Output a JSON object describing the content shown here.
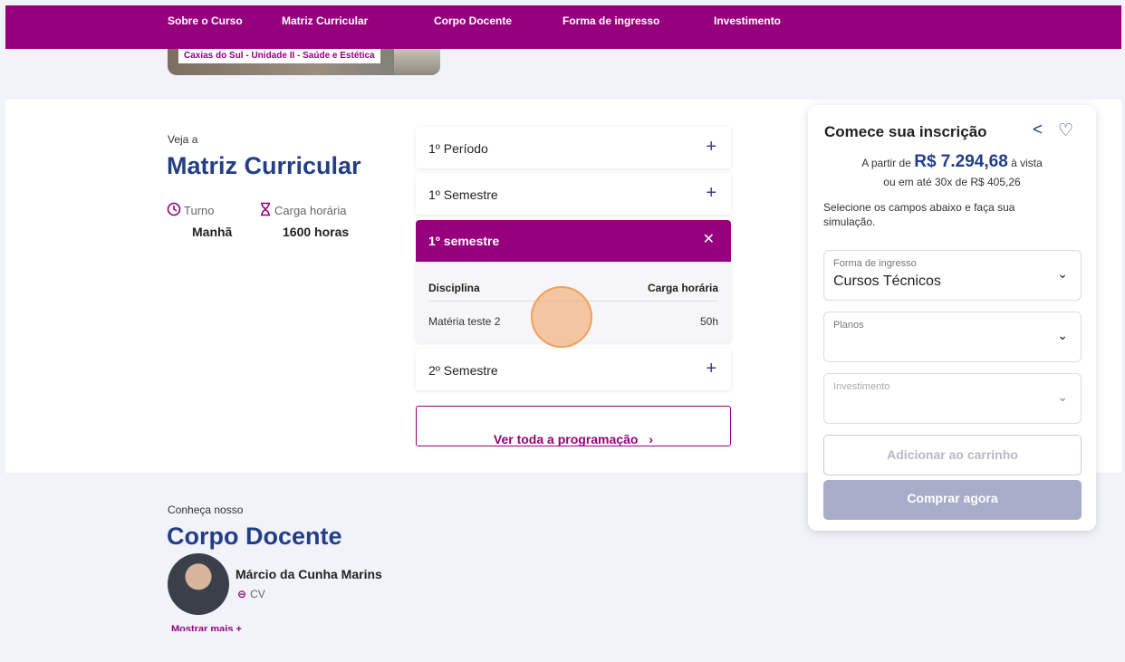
{
  "nav": {
    "items": [
      {
        "label": "Sobre o Curso"
      },
      {
        "label": "Matriz Curricular"
      },
      {
        "label": "Corpo Docente"
      },
      {
        "label": "Forma de ingresso"
      },
      {
        "label": "Investimento"
      }
    ]
  },
  "hero": {
    "campus": "Caxias do Sul - Unidade II - Saúde e Estética"
  },
  "matriz": {
    "eyebrow": "Veja a",
    "title": "Matriz Curricular",
    "turno_label": "Turno",
    "turno_value": "Manhã",
    "carga_label": "Carga horária",
    "carga_value": "1600 horas"
  },
  "accordion": {
    "items": [
      {
        "label": "1º Período"
      },
      {
        "label": "1º Semestre"
      }
    ],
    "open": {
      "label": "1º semestre",
      "col_disciplina": "Disciplina",
      "col_carga": "Carga horária",
      "rows": [
        {
          "disciplina": "Matéria teste 2",
          "carga": "50h"
        }
      ]
    },
    "after": [
      {
        "label": "2º Semestre"
      }
    ],
    "ver_toda": "Ver toda a programação"
  },
  "docentes": {
    "eyebrow": "Conheça nosso",
    "title": "Corpo Docente",
    "teacher_name": "Márcio da Cunha Marins",
    "cv_label": "CV",
    "mostrar": "Mostrar mais +"
  },
  "inscricao": {
    "title": "Comece sua inscrição",
    "price_prefix": "A partir de",
    "price": "R$ 7.294,68",
    "price_suffix": "à vista",
    "installments": "ou em até 30x de R$ 405,26",
    "helper": "Selecione os campos abaixo e faça sua simulação.",
    "fields": {
      "forma_label": "Forma de ingresso",
      "forma_value": "Cursos Técnicos",
      "planos_label": "Planos",
      "planos_value": "",
      "invest_label": "Investimento",
      "invest_value": ""
    },
    "add_cart": "Adicionar ao carrinho",
    "buy_now": "Comprar agora"
  },
  "colors": {
    "brand_purple": "#96007d",
    "navy": "#233e87",
    "disabled_button": "#a8acc9"
  }
}
